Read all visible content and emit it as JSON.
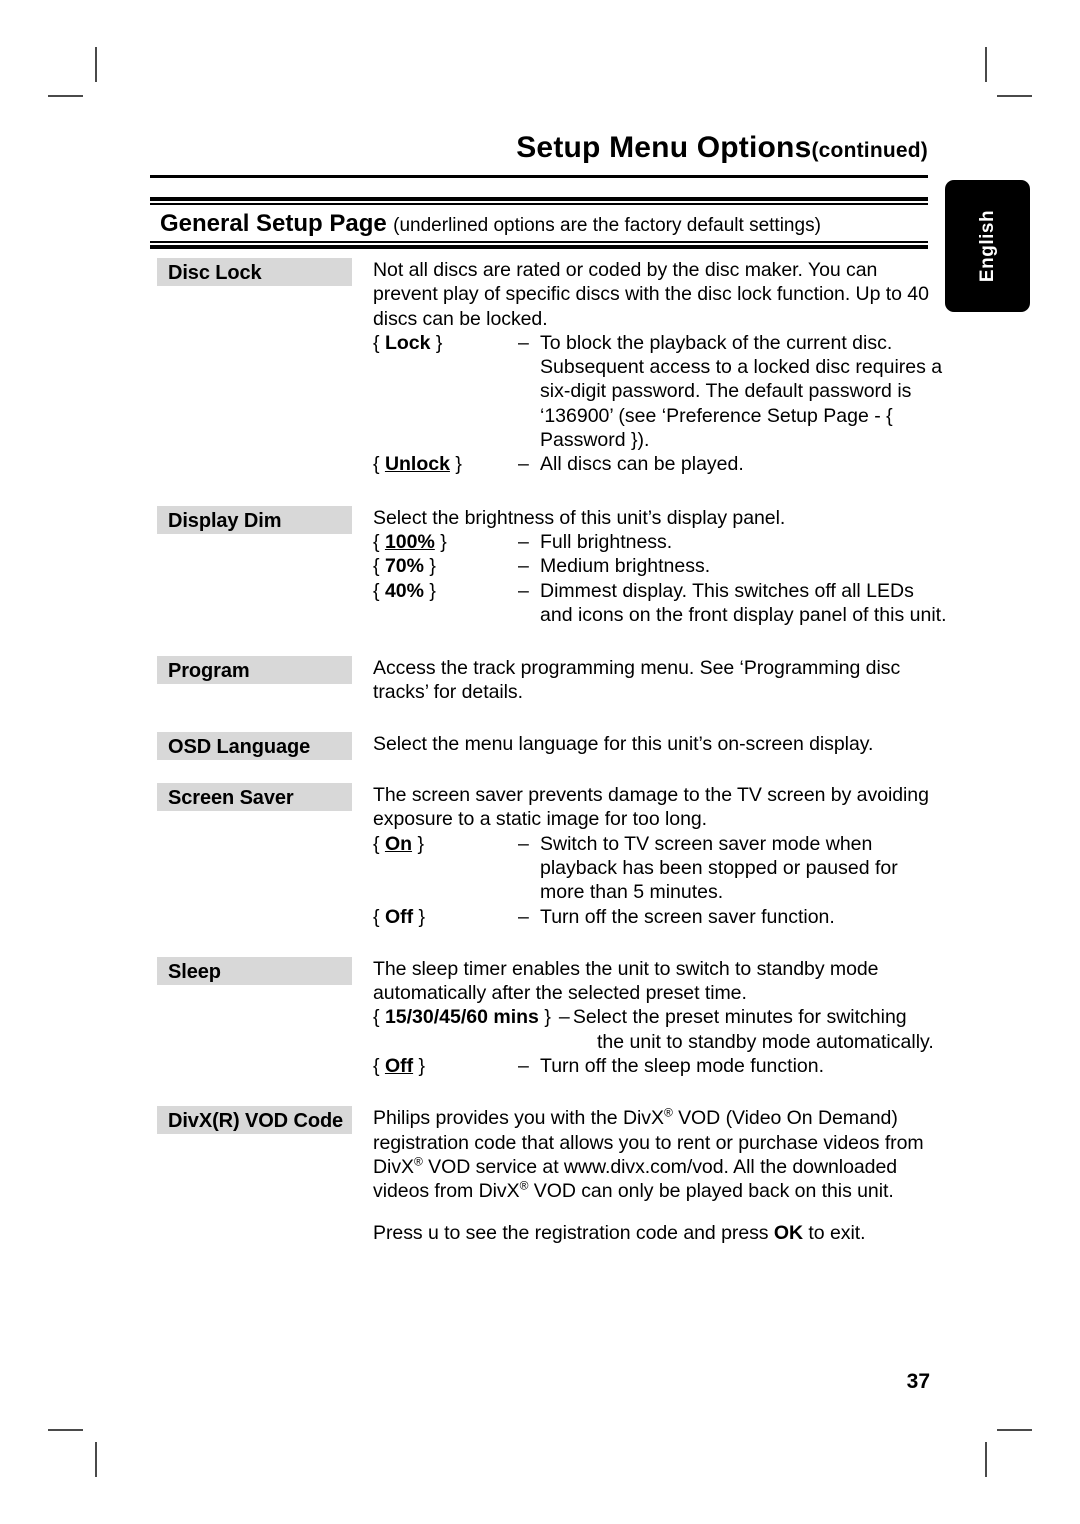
{
  "header": {
    "title": "Setup Menu Options",
    "title_suffix": "(continued)",
    "section_title": "General Setup Page",
    "section_note": "(underlined options are the factory default settings)"
  },
  "language_tab": {
    "label": "English"
  },
  "page_number": "37",
  "entries": [
    {
      "label": "Disc Lock",
      "paragraph": "Not all discs are rated or coded by the disc maker. You can prevent play of specific discs with the disc lock function. Up to 40 discs can be locked.",
      "options": [
        {
          "key_open": "{",
          "key": "Lock",
          "key_close": "}",
          "dash": "–",
          "desc": "To block the playback of the current disc. Subsequent access to a locked disc requires a six-digit password. The default password is ‘136900’ (see ‘Preference Setup Page - { Password })."
        },
        {
          "key_open": "{",
          "key": "Unlock",
          "key_close": "}",
          "dash": "–",
          "desc": "All discs can be played."
        }
      ]
    },
    {
      "label": "Display Dim",
      "paragraph": "Select the brightness of this unit’s display panel.",
      "options": [
        {
          "key_open": "{",
          "key": "100%",
          "key_close": "}",
          "dash": "–",
          "desc": "Full brightness."
        },
        {
          "key_open": "{",
          "key": "70%",
          "key_close": "}",
          "dash": "–",
          "desc": "Medium brightness."
        },
        {
          "key_open": "{",
          "key": "40%",
          "key_close": "}",
          "dash": "–",
          "desc": "Dimmest display.  This switches off all LEDs and icons on the front display panel of this unit."
        }
      ]
    },
    {
      "label": "Program",
      "paragraph": "Access the track programming menu. See ‘Programming disc tracks’ for details.",
      "options": []
    },
    {
      "label": "OSD Language",
      "paragraph": "Select the menu language for this unit’s on-screen display.",
      "options": []
    },
    {
      "label": "Screen Saver",
      "paragraph": "The screen saver prevents damage to the TV screen by avoiding exposure to a static image for too long.",
      "options": [
        {
          "key_open": "{",
          "key": "On",
          "key_close": "}",
          "dash": "–",
          "desc": "Switch to TV screen saver mode when playback has been stopped or paused for more than 5 minutes."
        },
        {
          "key_open": "{",
          "key": "Off",
          "key_close": "}",
          "dash": "–",
          "desc": "Turn off the screen saver function."
        }
      ]
    },
    {
      "label": "Sleep",
      "paragraph": "The sleep timer enables the unit to switch to standby mode automatically after the selected preset time.",
      "options": [
        {
          "key_open": "{",
          "key": "15/30/45/60 mins",
          "key_close": "}",
          "dash": "–",
          "desc": "Select the preset minutes for switching",
          "desc_cont": "the unit to standby mode automatically."
        },
        {
          "key_open": "{",
          "key": "Off",
          "key_close": "}",
          "dash": "–",
          "desc": "Turn off the sleep mode function."
        }
      ]
    },
    {
      "label": "DivX(R) VOD Code",
      "paragraph_parts": {
        "p1a": "Philips provides you with the DivX",
        "sup1": "®",
        "p1b": " VOD (Video On Demand) registration code that allows you to rent or purchase videos from DivX",
        "sup2": "®",
        "p1c": " VOD service at www.divx.com/vod. All the downloaded videos from DivX",
        "sup3": "®",
        "p1d": " VOD can only be played back on this unit."
      },
      "paragraph2_parts": {
        "a": "Press u  to see the registration code and press ",
        "ok": "OK",
        "b": " to exit."
      },
      "options": []
    }
  ]
}
